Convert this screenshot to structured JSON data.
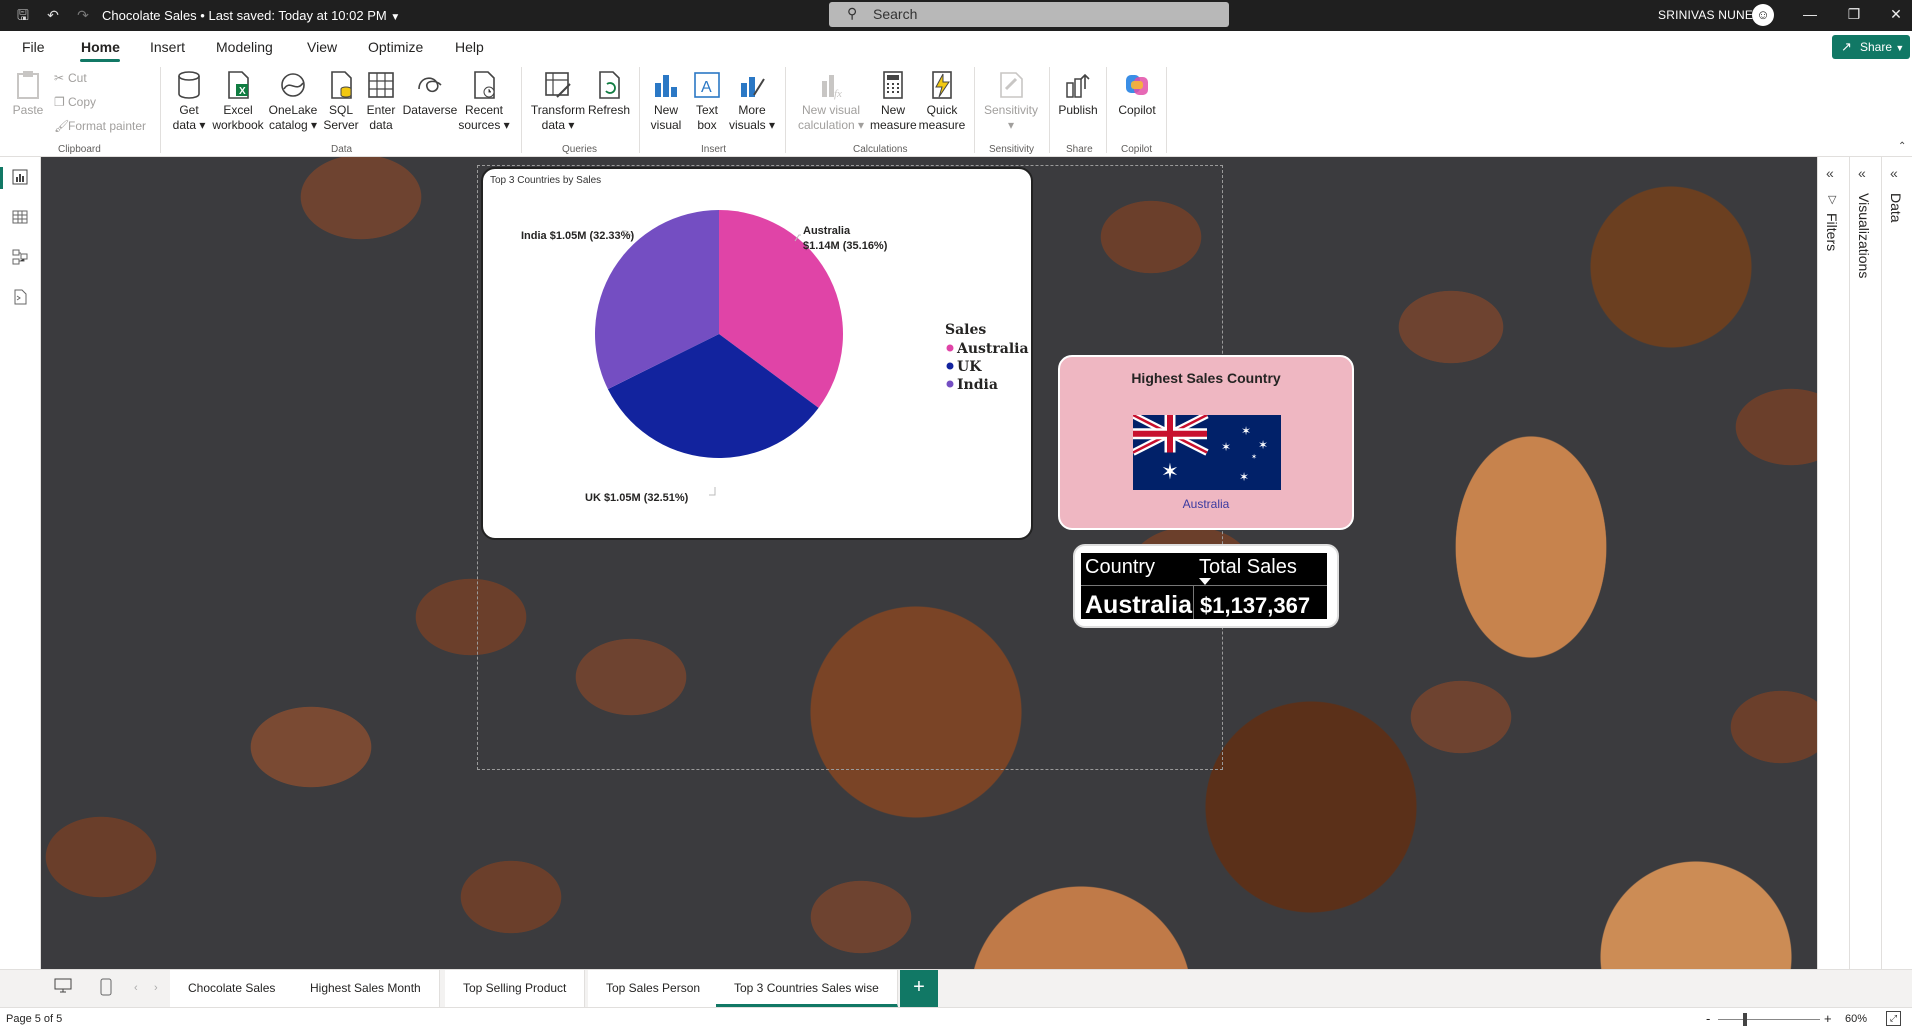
{
  "titlebar": {
    "document_name": "Chocolate Sales",
    "saved_status": "• Last saved: Today at 10:02 PM",
    "search_placeholder": "Search",
    "user_name": "SRINIVAS NUNE"
  },
  "menu": {
    "tabs": [
      "File",
      "Home",
      "Insert",
      "Modeling",
      "View",
      "Optimize",
      "Help"
    ],
    "active_tab": "Home",
    "share_label": "Share"
  },
  "ribbon": {
    "clipboard": {
      "paste": "Paste",
      "cut": "Cut",
      "copy": "Copy",
      "format_painter": "Format painter",
      "label": "Clipboard"
    },
    "data": {
      "label": "Data",
      "buttons": [
        {
          "line1": "Get",
          "line2": "data ▾"
        },
        {
          "line1": "Excel",
          "line2": "workbook"
        },
        {
          "line1": "OneLake",
          "line2": "catalog ▾"
        },
        {
          "line1": "SQL",
          "line2": "Server"
        },
        {
          "line1": "Enter",
          "line2": "data"
        },
        {
          "line1": "Dataverse",
          "line2": ""
        },
        {
          "line1": "Recent",
          "line2": "sources ▾"
        }
      ]
    },
    "queries": {
      "label": "Queries",
      "buttons": [
        {
          "line1": "Transform",
          "line2": "data ▾"
        },
        {
          "line1": "Refresh",
          "line2": ""
        }
      ]
    },
    "insert": {
      "label": "Insert",
      "buttons": [
        {
          "line1": "New",
          "line2": "visual"
        },
        {
          "line1": "Text",
          "line2": "box"
        },
        {
          "line1": "More",
          "line2": "visuals ▾"
        }
      ]
    },
    "calculations": {
      "label": "Calculations",
      "buttons": [
        {
          "line1": "New visual",
          "line2": "calculation ▾"
        },
        {
          "line1": "New",
          "line2": "measure"
        },
        {
          "line1": "Quick",
          "line2": "measure"
        }
      ]
    },
    "sensitivity": {
      "label": "Sensitivity",
      "button": "Sensitivity",
      "sub": "▾"
    },
    "share": {
      "label": "Share",
      "button": "Publish"
    },
    "copilot": {
      "label": "Copilot",
      "button": "Copilot"
    }
  },
  "panes": {
    "filters": "Filters",
    "visualizations": "Visualizations",
    "data": "Data"
  },
  "pie_visual": {
    "title": "Top 3 Countries by Sales",
    "labels": {
      "australia_line1": "Australia",
      "australia_line2": "$1.14M (35.16%)",
      "india": "India $1.05M (32.33%)",
      "uk": "UK $1.05M (32.51%)"
    }
  },
  "chart_data": {
    "type": "pie",
    "title": "Top 3 Countries by Sales",
    "legend_title": "Sales",
    "legend_position": "right",
    "categories": [
      "Australia",
      "UK",
      "India"
    ],
    "values_millions": [
      1.14,
      1.05,
      1.05
    ],
    "percentages": [
      35.16,
      32.51,
      32.33
    ],
    "colors": [
      "#e044a7",
      "#12239e",
      "#744ec2"
    ]
  },
  "country_card": {
    "title": "Highest Sales Country",
    "country": "Australia"
  },
  "sales_table": {
    "headers": [
      "Country",
      "Total Sales"
    ],
    "row": [
      "Australia",
      "$1,137,367"
    ]
  },
  "page_tabs": {
    "tabs": [
      "Chocolate Sales",
      "Highest Sales Month",
      "Top Selling Product",
      "Top Sales Person",
      "Top 3 Countries Sales wise"
    ],
    "active": "Top 3 Countries Sales wise",
    "add": "+"
  },
  "status": {
    "page_info": "Page 5 of 5",
    "zoom_level": "60%",
    "zoom_minus": "-",
    "zoom_plus": "+"
  },
  "colors": {
    "accent": "#117865",
    "card_background": "#efb7c2",
    "titlebar": "#1f1f1f"
  }
}
